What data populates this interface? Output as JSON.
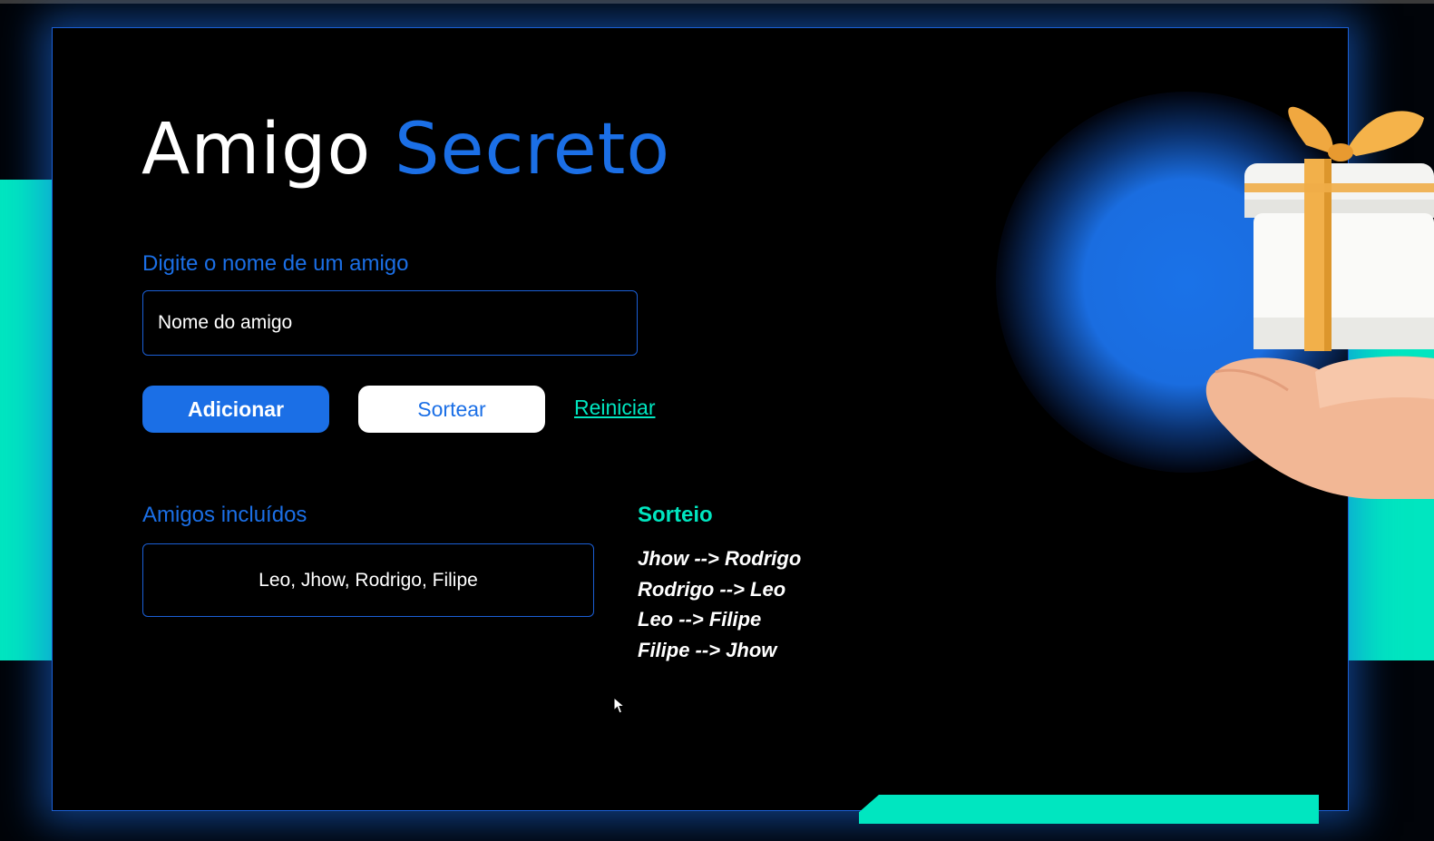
{
  "app": {
    "title_part1": "Amigo",
    "title_part2": "Secreto"
  },
  "form": {
    "input_label": "Digite o nome de um amigo",
    "input_placeholder": "Nome do amigo",
    "input_value": ""
  },
  "actions": {
    "add_label": "Adicionar",
    "draw_label": "Sortear",
    "reset_label": "Reiniciar"
  },
  "friends": {
    "heading": "Amigos incluídos",
    "list_text": "Leo, Jhow, Rodrigo, Filipe"
  },
  "draw": {
    "heading": "Sorteio",
    "results": [
      "Jhow --> Rodrigo",
      "Rodrigo --> Leo",
      "Leo --> Filipe",
      "Filipe --> Jhow"
    ]
  },
  "colors": {
    "primary_blue": "#1b6fe6",
    "accent_teal": "#00e6c0",
    "background": "#000000",
    "text": "#ffffff"
  },
  "icons": {
    "illustration": "gift-on-hand-illustration",
    "cursor": "mouse-pointer-icon"
  }
}
